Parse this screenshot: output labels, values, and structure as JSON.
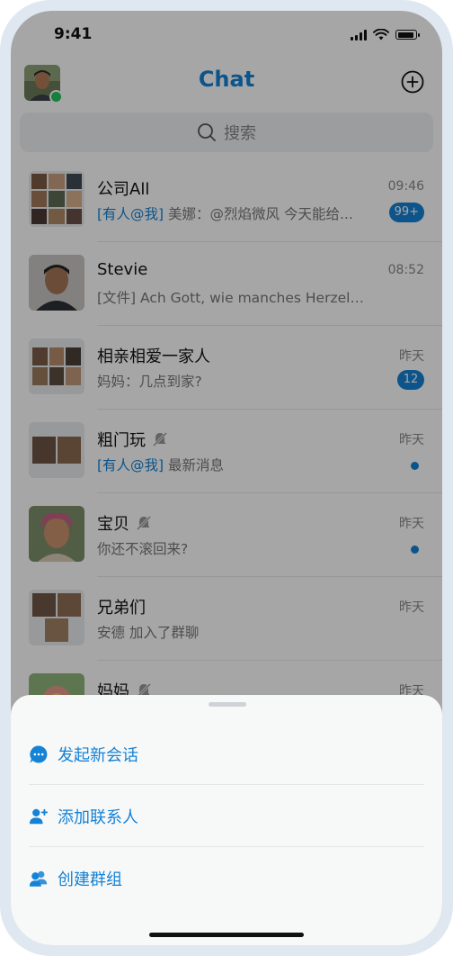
{
  "status": {
    "time": "9:41"
  },
  "header": {
    "title": "Chat"
  },
  "search": {
    "placeholder": "搜索"
  },
  "chats": [
    {
      "name": "公司All",
      "time": "09:46",
      "mention": "[有人@我]",
      "message": "美娜：@烈焰微风 今天能给...",
      "badge": "99+",
      "muted": false
    },
    {
      "name": "Stevie",
      "time": "08:52",
      "mention": "",
      "message": "[文件] Ach Gott, wie manches Herzeleid,BW...",
      "badge": "",
      "muted": false
    },
    {
      "name": "相亲相爱一家人",
      "time": "昨天",
      "mention": "",
      "message": "妈妈：几点到家?",
      "badge": "12",
      "muted": false
    },
    {
      "name": "粗门玩",
      "time": "昨天",
      "mention": "[有人@我]",
      "message": "最新消息",
      "badge": "",
      "dot": true,
      "muted": true
    },
    {
      "name": "宝贝",
      "time": "昨天",
      "mention": "",
      "message": "你还不滚回来?",
      "badge": "",
      "dot": true,
      "muted": true
    },
    {
      "name": "兄弟们",
      "time": "昨天",
      "mention": "",
      "message": "安德 加入了群聊",
      "badge": "",
      "muted": false
    },
    {
      "name": "妈妈",
      "time": "昨天",
      "mention": "",
      "message": "",
      "badge": "",
      "muted": true
    }
  ],
  "sheet": {
    "items": [
      {
        "label": "发起新会话",
        "icon": "chat-bubble-icon"
      },
      {
        "label": "添加联系人",
        "icon": "add-contact-icon"
      },
      {
        "label": "创建群组",
        "icon": "create-group-icon"
      }
    ]
  },
  "colors": {
    "accent": "#1482d6",
    "online": "#22c55e"
  }
}
